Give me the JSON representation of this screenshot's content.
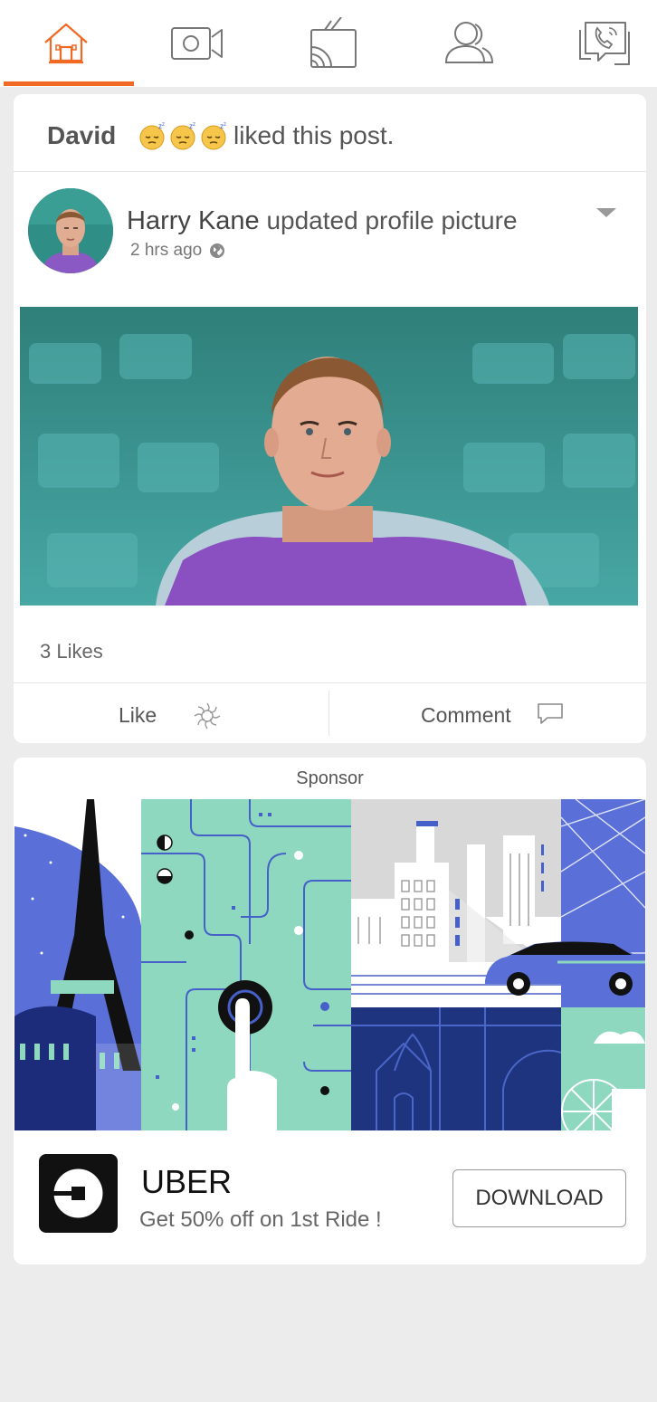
{
  "nav": {
    "tabs": [
      {
        "name": "home",
        "icon": "home-icon",
        "active": true
      },
      {
        "name": "video",
        "icon": "video-camera-icon",
        "active": false
      },
      {
        "name": "watch",
        "icon": "cast-tv-icon",
        "active": false
      },
      {
        "name": "friends",
        "icon": "users-icon",
        "active": false
      },
      {
        "name": "calls",
        "icon": "phone-chat-icon",
        "active": false
      }
    ],
    "accent_color": "#f06a25",
    "inactive_icon_color": "#777777"
  },
  "post": {
    "liked_by": "David",
    "liked_text": "liked this post.",
    "reaction_emoji_count": 3,
    "author": "Harry Kane",
    "action": "updated profile picture",
    "time": "2 hrs ago",
    "likes": "3 Likes",
    "like_label": "Like",
    "comment_label": "Comment"
  },
  "ad": {
    "sponsor_label": "Sponsor",
    "brand": "UBER",
    "tagline": "Get 50% off on 1st Ride !",
    "cta": "DOWNLOAD",
    "banner_colors": [
      "#5a6fd8",
      "#8ed8c0",
      "#d8d8d8",
      "#223a8c",
      "#000000"
    ]
  }
}
